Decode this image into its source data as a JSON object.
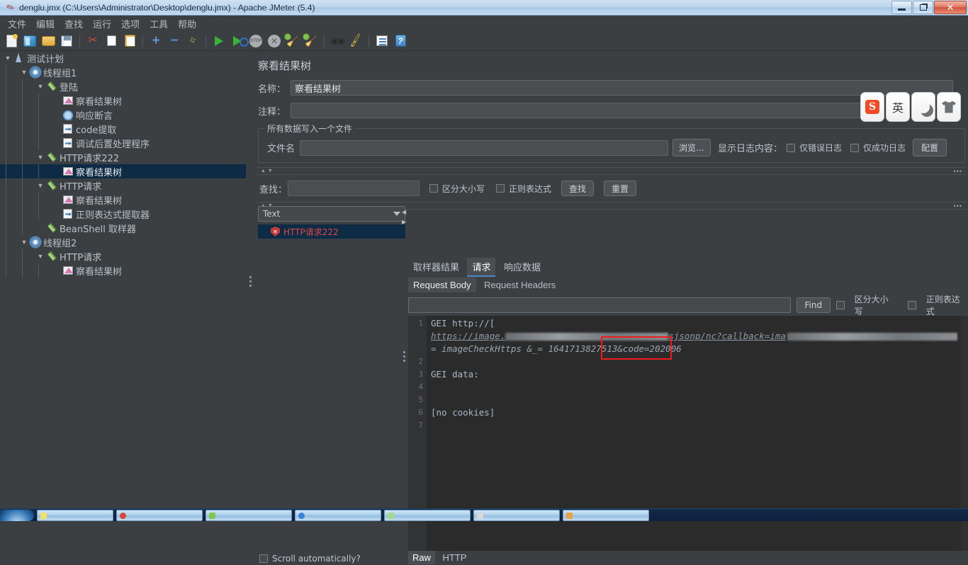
{
  "window": {
    "title": "denglu.jmx (C:\\Users\\Administrator\\Desktop\\denglu.jmx) - Apache JMeter (5.4)",
    "minimize_label": "",
    "maximize_label": "",
    "close_label": "✕"
  },
  "menubar": {
    "items": [
      {
        "label": "文件"
      },
      {
        "label": "编辑"
      },
      {
        "label": "查找"
      },
      {
        "label": "运行"
      },
      {
        "label": "选项"
      },
      {
        "label": "工具"
      },
      {
        "label": "帮助"
      }
    ]
  },
  "toolbar": {
    "buttons": [
      {
        "icon": "new-document-icon"
      },
      {
        "icon": "templates-icon"
      },
      {
        "icon": "open-folder-icon"
      },
      {
        "icon": "save-icon"
      },
      {
        "icon": "cut-icon"
      },
      {
        "icon": "copy-icon"
      },
      {
        "icon": "paste-icon"
      },
      {
        "icon": "expand-icon"
      },
      {
        "icon": "collapse-icon"
      },
      {
        "icon": "toggle-icon"
      },
      {
        "icon": "start-icon"
      },
      {
        "icon": "start-no-pauses-icon"
      },
      {
        "icon": "stop-icon"
      },
      {
        "icon": "shutdown-icon"
      },
      {
        "icon": "clear-icon"
      },
      {
        "icon": "clear-all-icon"
      },
      {
        "icon": "search-icon"
      },
      {
        "icon": "reset-search-icon"
      },
      {
        "icon": "function-helper-icon"
      },
      {
        "icon": "help-icon"
      }
    ]
  },
  "tree": {
    "nodes": [
      {
        "label": "测试计划",
        "depth": 0,
        "icon": "test-plan-icon",
        "toggle": "v",
        "selected": false
      },
      {
        "label": "线程组1",
        "depth": 1,
        "icon": "thread-group-icon",
        "toggle": "v",
        "selected": false
      },
      {
        "label": "登陆",
        "depth": 2,
        "icon": "http-sampler-icon",
        "toggle": "v",
        "selected": false
      },
      {
        "label": "察看结果树",
        "depth": 3,
        "icon": "view-results-tree-icon",
        "toggle": "",
        "selected": false
      },
      {
        "label": "响应断言",
        "depth": 3,
        "icon": "response-assertion-icon",
        "toggle": "",
        "selected": false
      },
      {
        "label": "code提取",
        "depth": 3,
        "icon": "post-processor-icon",
        "toggle": "",
        "selected": false
      },
      {
        "label": "调试后置处理程序",
        "depth": 3,
        "icon": "post-processor-icon",
        "toggle": "",
        "selected": false
      },
      {
        "label": "HTTP请求222",
        "depth": 2,
        "icon": "http-sampler-icon",
        "toggle": "v",
        "selected": false
      },
      {
        "label": "察看结果树",
        "depth": 3,
        "icon": "view-results-tree-icon",
        "toggle": "",
        "selected": true
      },
      {
        "label": "HTTP请求",
        "depth": 2,
        "icon": "http-sampler-icon",
        "toggle": "v",
        "selected": false
      },
      {
        "label": "察看结果树",
        "depth": 3,
        "icon": "view-results-tree-icon",
        "toggle": "",
        "selected": false
      },
      {
        "label": "正则表达式提取器",
        "depth": 3,
        "icon": "post-processor-icon",
        "toggle": "",
        "selected": false
      },
      {
        "label": "BeanShell 取样器",
        "depth": 2,
        "icon": "beanshell-sampler-icon",
        "toggle": "",
        "selected": false
      },
      {
        "label": "线程组2",
        "depth": 1,
        "icon": "thread-group-icon",
        "toggle": "v",
        "selected": false
      },
      {
        "label": "HTTP请求",
        "depth": 2,
        "icon": "http-sampler-icon",
        "toggle": "v",
        "selected": false
      },
      {
        "label": "察看结果树",
        "depth": 3,
        "icon": "view-results-tree-icon",
        "toggle": "",
        "selected": false
      }
    ]
  },
  "panel": {
    "title": "察看结果树",
    "name_label": "名称：",
    "name_value": "察看结果树",
    "comment_label": "注释：",
    "comment_value": "",
    "file_group_title": "所有数据写入一个文件",
    "filename_label": "文件名",
    "filename_value": "",
    "browse_button": "浏览…",
    "log_display_label": "显示日志内容：",
    "errors_only_label": "仅错误日志",
    "successes_only_label": "仅成功日志",
    "configure_button": "配置",
    "search_label": "查找：",
    "search_value": "",
    "case_sensitive_label": "区分大小写",
    "regexp_label": "正则表达式",
    "search_button": "查找",
    "reset_button": "重置",
    "collapse_dots": "•••"
  },
  "results": {
    "renderer_selected": "Text",
    "entries": [
      {
        "label": "HTTP请求222",
        "status": "failed",
        "icon": "error-shield-icon"
      }
    ],
    "scroll_auto_label": "Scroll automatically?"
  },
  "tabs": {
    "main": [
      {
        "label": "取样器结果",
        "active": false
      },
      {
        "label": "请求",
        "active": true
      },
      {
        "label": "响应数据",
        "active": false
      }
    ],
    "sub": [
      {
        "label": "Request Body",
        "active": true
      },
      {
        "label": "Request Headers",
        "active": false
      }
    ],
    "bottom": [
      {
        "label": "Raw",
        "active": true
      },
      {
        "label": "HTTP",
        "active": false
      }
    ]
  },
  "find": {
    "value": "",
    "button": "Find",
    "case_sensitive_label": "区分大小写",
    "regexp_label": "正则表达式"
  },
  "editor": {
    "line_numbers": [
      "1",
      "2",
      "3",
      "4",
      "5",
      "6",
      "7"
    ],
    "lines": [
      {
        "num": "1",
        "text": "GEI http://["
      },
      {
        "num": "",
        "text": "https://image.",
        "type": "url",
        "redacted_tail": "sjsonp/nc?callback=ima"
      },
      {
        "num": "",
        "text": "= imageCheckHttps &_= 1641713827513&code=202006",
        "type": "cont"
      },
      {
        "num": "2",
        "text": ""
      },
      {
        "num": "3",
        "text": "GEI data:"
      },
      {
        "num": "4",
        "text": ""
      },
      {
        "num": "5",
        "text": ""
      },
      {
        "num": "6",
        "text": "[no cookies]"
      },
      {
        "num": "7",
        "text": ""
      }
    ],
    "highlight_text": "&code=202006",
    "highlight_color": "#ee1c1c"
  },
  "ime": {
    "buttons": [
      {
        "name": "sogou-logo",
        "glyph": "S"
      },
      {
        "name": "english-mode",
        "glyph": "英"
      },
      {
        "name": "moon-mode",
        "glyph": ""
      },
      {
        "name": "skin-mode",
        "glyph": ""
      }
    ]
  },
  "taskbar": {
    "items": [
      {
        "color": "#f0e06a"
      },
      {
        "color": "#d8463c"
      },
      {
        "color": "#7ec850"
      },
      {
        "color": "#3b82d9"
      },
      {
        "color": "#a8d98a"
      },
      {
        "color": "#d8d8d8"
      },
      {
        "color": "#e8a23c"
      }
    ],
    "clock": ""
  },
  "colors": {
    "panel_bg": "#3c3f41",
    "editor_bg": "#2b2b2b",
    "selection": "#0d2b45",
    "accent": "#4a88c7",
    "error": "#e04747"
  }
}
